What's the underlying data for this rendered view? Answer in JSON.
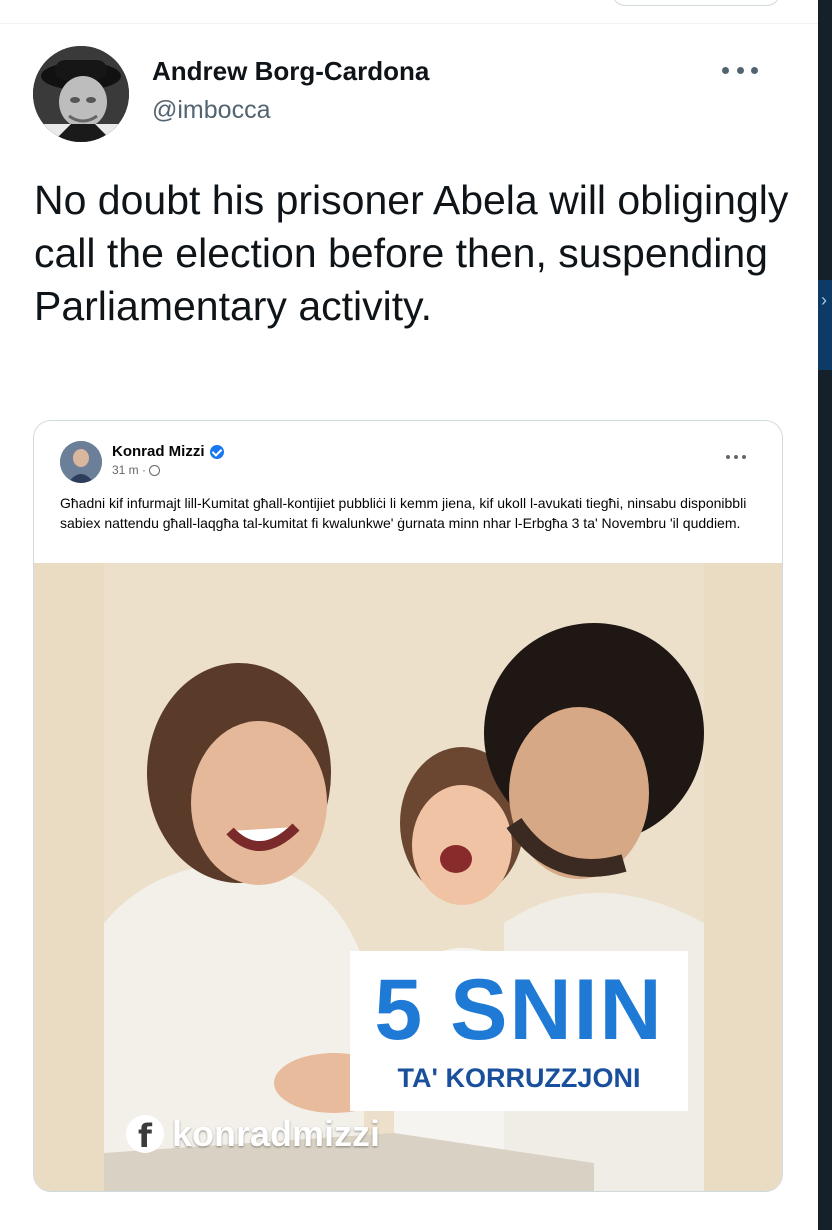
{
  "tweet": {
    "author_name": "Andrew Borg-Cardona",
    "author_handle": "@imbocca",
    "text": "No doubt his prisoner Abela will obligingly call the election before then, suspending Parliamentary activity."
  },
  "embedded_post": {
    "author_name": "Konrad Mizzi",
    "time": "31 m ·",
    "text": "Għadni kif infurmajt lill-Kumitat għall-kontijiet pubbliċi li kemm jiena, kif ukoll l-avukati tiegħi, ninsabu disponibbli sabiex nattendu għall-laqgħa tal-kumitat fi kwalunkwe' ġurnata minn nhar l-Erbgħa 3 ta' Novembru 'il quddiem.",
    "image": {
      "headline": "5 SNIN",
      "subline": "TA' KORRUZZJONI",
      "watermark": "konradmizzi",
      "accent_color": "#1f7ad6"
    }
  },
  "icons": {
    "more": "more-dots-icon",
    "verified": "verified-badge-icon",
    "globe": "globe-icon",
    "facebook": "facebook-logo-icon"
  }
}
